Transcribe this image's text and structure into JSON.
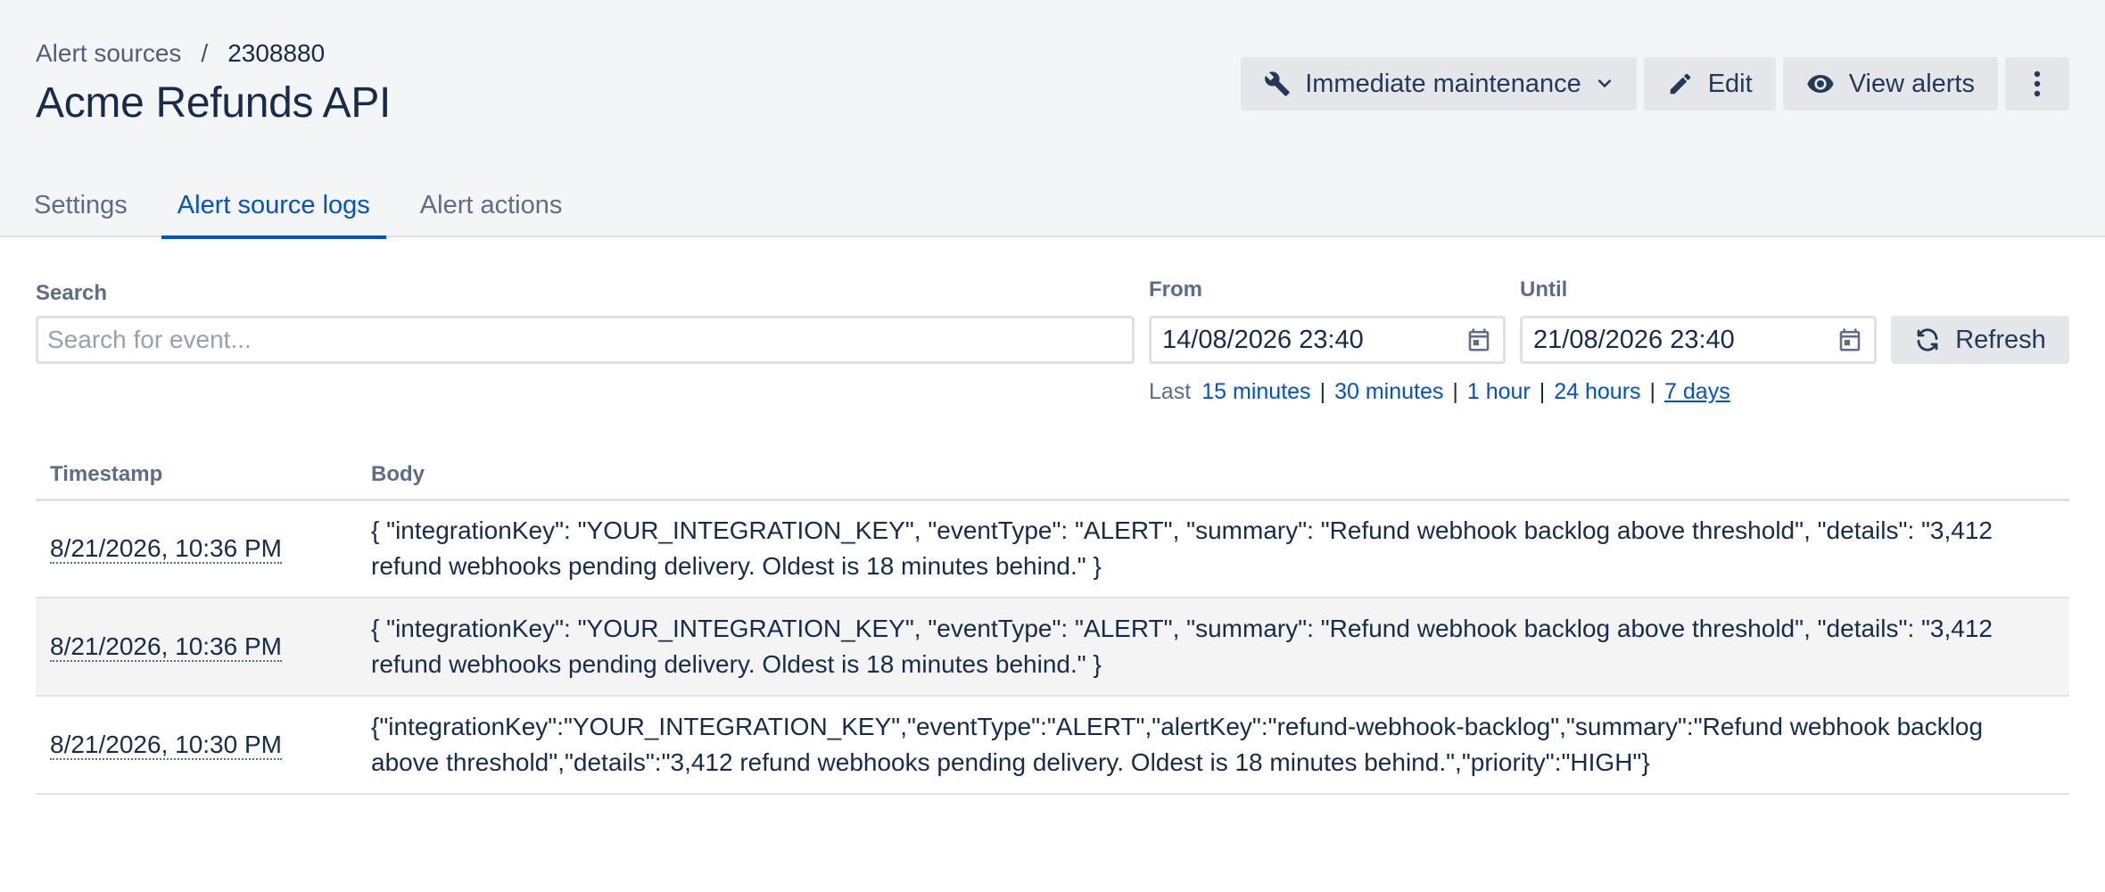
{
  "breadcrumb": {
    "parent": "Alert sources",
    "separator": "/",
    "current": "2308880"
  },
  "page_title": "Acme Refunds API",
  "actions": {
    "maintenance_label": "Immediate maintenance",
    "edit_label": "Edit",
    "view_alerts_label": "View alerts"
  },
  "tabs": [
    {
      "label": "Settings",
      "active": false
    },
    {
      "label": "Alert source logs",
      "active": true
    },
    {
      "label": "Alert actions",
      "active": false
    }
  ],
  "filters": {
    "search_label": "Search",
    "search_placeholder": "Search for event...",
    "search_value": "",
    "from_label": "From",
    "from_value": "14/08/2026 23:40",
    "until_label": "Until",
    "until_value": "21/08/2026 23:40",
    "refresh_label": "Refresh",
    "quick_prefix": "Last",
    "quick_ranges": [
      "15 minutes",
      "30 minutes",
      "1 hour",
      "24 hours",
      "7 days"
    ],
    "selected_range": "7 days"
  },
  "table": {
    "columns": [
      "Timestamp",
      "Body"
    ],
    "rows": [
      {
        "timestamp": "8/21/2026, 10:36 PM",
        "body": "{ \"integrationKey\": \"YOUR_INTEGRATION_KEY\", \"eventType\": \"ALERT\", \"summary\": \"Refund webhook backlog above threshold\", \"details\": \"3,412 refund webhooks pending delivery. Oldest is 18 minutes behind.\" }"
      },
      {
        "timestamp": "8/21/2026, 10:36 PM",
        "body": "{ \"integrationKey\": \"YOUR_INTEGRATION_KEY\", \"eventType\": \"ALERT\", \"summary\": \"Refund webhook backlog above threshold\", \"details\": \"3,412 refund webhooks pending delivery. Oldest is 18 minutes behind.\" }"
      },
      {
        "timestamp": "8/21/2026, 10:30 PM",
        "body": "{\"integrationKey\":\"YOUR_INTEGRATION_KEY\",\"eventType\":\"ALERT\",\"alertKey\":\"refund-webhook-backlog\",\"summary\":\"Refund webhook backlog above threshold\",\"details\":\"3,412 refund webhooks pending delivery. Oldest is 18 minutes behind.\",\"priority\":\"HIGH\"}"
      }
    ]
  },
  "colors": {
    "accent": "#0052cc",
    "header_bg": "#f4f5f7",
    "button_bg": "#e4e6ea",
    "text": "#172b4d",
    "muted": "#5e6c84"
  },
  "icons": {
    "maintenance": "wrench-icon",
    "edit": "pencil-icon",
    "view_alerts": "eye-icon",
    "more": "kebab-menu-icon",
    "dropdown": "chevron-down-icon",
    "date": "calendar-icon",
    "refresh": "refresh-icon"
  }
}
